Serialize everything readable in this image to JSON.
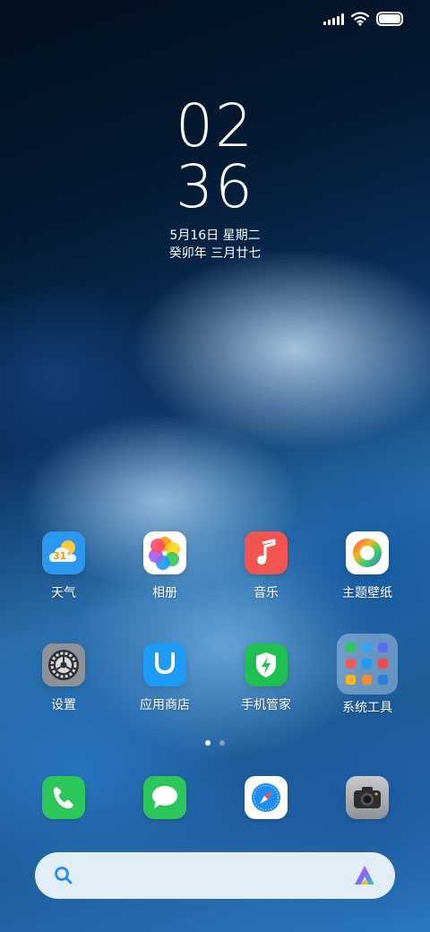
{
  "lock": {
    "hour": "02",
    "minute": "36",
    "date": "5月16日 星期二",
    "lunar": "癸卯年 三月廿七"
  },
  "status": {
    "signal_icon": "signal-icon",
    "wifi_icon": "wifi-icon",
    "battery_icon": "battery-icon"
  },
  "apps": [
    {
      "label": "天气",
      "icon": "weather-icon",
      "temp": "31°"
    },
    {
      "label": "相册",
      "icon": "gallery-icon"
    },
    {
      "label": "音乐",
      "icon": "music-icon"
    },
    {
      "label": "主题壁纸",
      "icon": "themes-icon"
    },
    {
      "label": "设置",
      "icon": "settings-icon"
    },
    {
      "label": "应用商店",
      "icon": "app-store-icon"
    },
    {
      "label": "手机管家",
      "icon": "security-icon"
    },
    {
      "label": "系统工具",
      "icon": "folder-icon"
    }
  ],
  "dock": [
    {
      "icon": "phone-icon"
    },
    {
      "icon": "messages-icon"
    },
    {
      "icon": "browser-icon"
    },
    {
      "icon": "camera-icon"
    }
  ],
  "search": {
    "search_icon": "search-icon",
    "assistant_icon": "assistant-icon"
  },
  "colors": {
    "weather": "#2b97ef",
    "music": "#f2544f",
    "app_store": "#1e9bf5",
    "security": "#1fbf52",
    "phone": "#2dc65a",
    "messages": "#2dc65a",
    "settings": "#8e9298"
  }
}
